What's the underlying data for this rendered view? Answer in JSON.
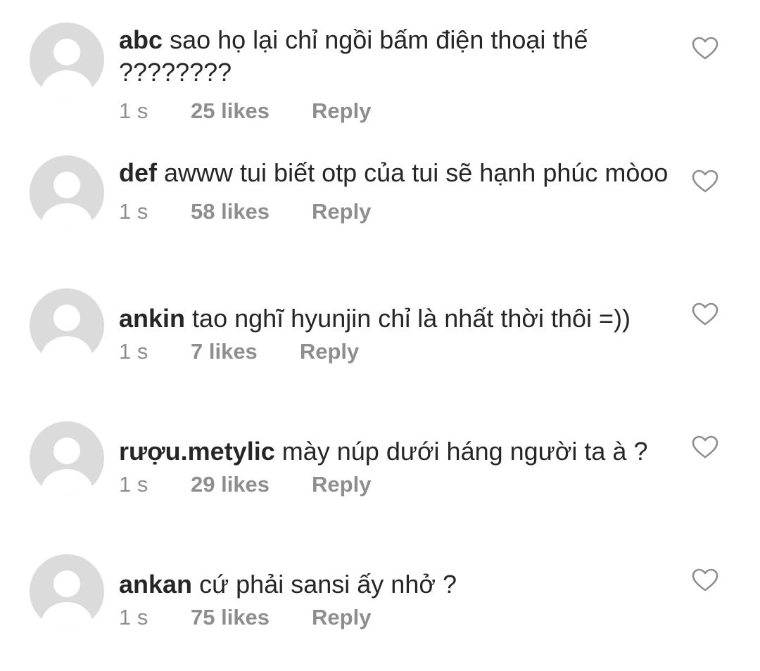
{
  "comments": [
    {
      "username": "abc",
      "text": "sao họ lại chỉ ngồi bấm điện thoại thế ????????",
      "time": "1 s",
      "likes": "25 likes",
      "reply": "Reply",
      "avatar_icon": "default-avatar-icon",
      "like_icon": "heart-outline-icon"
    },
    {
      "username": "def",
      "text": "awww tui biết otp của tui sẽ hạnh phúc mòoo",
      "time": "1 s",
      "likes": "58 likes",
      "reply": "Reply",
      "avatar_icon": "default-avatar-icon",
      "like_icon": "heart-outline-icon"
    },
    {
      "username": "ankin",
      "text": "tao nghĩ hyunjin chỉ là nhất thời thôi =))",
      "time": "1 s",
      "likes": "7 likes",
      "reply": "Reply",
      "avatar_icon": "default-avatar-icon",
      "like_icon": "heart-outline-icon"
    },
    {
      "username": "rượu.metylic",
      "text": "mày núp dưới háng người ta à ?",
      "time": "1 s",
      "likes": "29 likes",
      "reply": "Reply",
      "avatar_icon": "default-avatar-icon",
      "like_icon": "heart-outline-icon"
    },
    {
      "username": "ankan",
      "text": "cứ phải sansi ấy nhở ?",
      "time": "1 s",
      "likes": "75 likes",
      "reply": "Reply",
      "avatar_icon": "default-avatar-icon",
      "like_icon": "heart-outline-icon"
    }
  ],
  "colors": {
    "text": "#262626",
    "meta": "#8e8e8e",
    "avatar_bg": "#dbdbdb",
    "avatar_fg": "#ffffff",
    "background": "#ffffff"
  }
}
